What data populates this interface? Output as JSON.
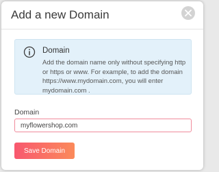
{
  "dialog": {
    "title": "Add a new Domain",
    "close_icon": "close-icon"
  },
  "info": {
    "icon": "info-icon",
    "title": "Domain",
    "text": "Add the domain name only without specifying http or https or www. For example, to add the domain https://www.mydomain.com, you will enter mydomain.com ."
  },
  "form": {
    "label": "Domain",
    "value": "myflowershop.com",
    "border_color": "#f08a9a"
  },
  "actions": {
    "save_label": "Save Domain",
    "accent_start": "#f8586f",
    "accent_end": "#fb8a5a"
  }
}
